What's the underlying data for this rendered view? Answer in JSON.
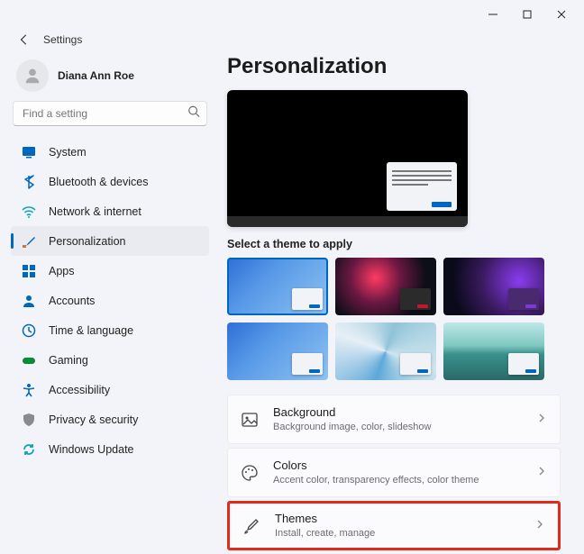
{
  "window": {
    "title": "Settings"
  },
  "profile": {
    "name": "Diana Ann Roe"
  },
  "search": {
    "placeholder": "Find a setting"
  },
  "sidebar": {
    "items": [
      {
        "label": "System"
      },
      {
        "label": "Bluetooth & devices"
      },
      {
        "label": "Network & internet"
      },
      {
        "label": "Personalization"
      },
      {
        "label": "Apps"
      },
      {
        "label": "Accounts"
      },
      {
        "label": "Time & language"
      },
      {
        "label": "Gaming"
      },
      {
        "label": "Accessibility"
      },
      {
        "label": "Privacy & security"
      },
      {
        "label": "Windows Update"
      }
    ]
  },
  "page": {
    "title": "Personalization",
    "themes_label": "Select a theme to apply",
    "options": [
      {
        "title": "Background",
        "subtitle": "Background image, color, slideshow"
      },
      {
        "title": "Colors",
        "subtitle": "Accent color, transparency effects, color theme"
      },
      {
        "title": "Themes",
        "subtitle": "Install, create, manage"
      }
    ]
  }
}
